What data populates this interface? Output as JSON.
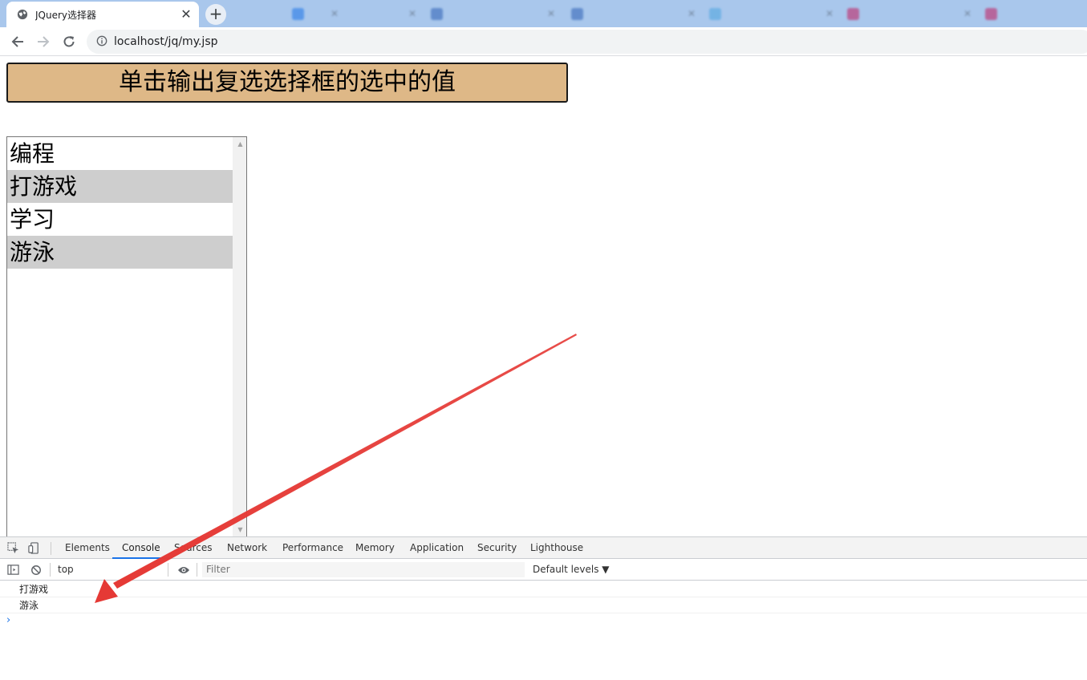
{
  "browser": {
    "active_tab": {
      "title": "JQuery选择器"
    },
    "background_tabs": [
      {
        "title": "",
        "color": "#1a73e8"
      },
      {
        "title": "",
        "color": "#1a73e8"
      },
      {
        "title": "",
        "color": "#2b5fb4"
      },
      {
        "title": "",
        "color": "#2b5fb4"
      },
      {
        "title": "",
        "color": "#4aa3df"
      },
      {
        "title": "",
        "color": "#c2185b"
      },
      {
        "title": "",
        "color": "#c2185b"
      }
    ],
    "address": "localhost/jq/my.jsp"
  },
  "page": {
    "button_label": "单击输出复选选择框的选中的值",
    "select_options": [
      {
        "label": "编程",
        "selected": false
      },
      {
        "label": "打游戏",
        "selected": true
      },
      {
        "label": "学习",
        "selected": false
      },
      {
        "label": "游泳",
        "selected": true
      }
    ]
  },
  "devtools": {
    "tabs": [
      "Elements",
      "Console",
      "Sources",
      "Network",
      "Performance",
      "Memory",
      "Application",
      "Security",
      "Lighthouse"
    ],
    "active_tab": "Console",
    "context": "top",
    "filter_placeholder": "Filter",
    "levels": "Default levels ▼",
    "console_lines": [
      "打游戏",
      "游泳"
    ],
    "prompt": "›"
  },
  "colors": {
    "button_bg": "#deb887",
    "selected_option_bg": "#cecece",
    "annotation_arrow": "#e53935",
    "tabstrip_bg": "#a9c7ec"
  }
}
